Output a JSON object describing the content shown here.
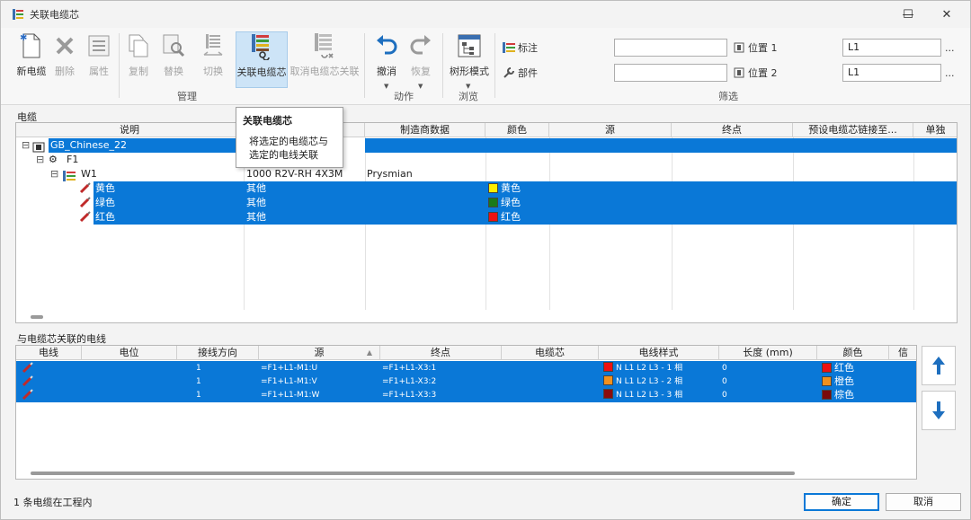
{
  "window": {
    "title": "关联电缆芯",
    "minimize": "—",
    "maximize": "☐",
    "close": "✕"
  },
  "toolbar": {
    "new_cable": "新电缆",
    "delete": "删除",
    "properties": "属性",
    "copy": "复制",
    "replace": "替换",
    "switch": "切换",
    "link_core": "关联电缆芯",
    "unlink_core": "取消电缆芯关联",
    "undo": "撤消",
    "redo": "恢复",
    "tree_mode": "树形模式",
    "group_manage": "管理",
    "group_action": "动作",
    "group_browse": "浏览",
    "group_filter": "筛选",
    "mark": "标注",
    "part": "部件",
    "position1": "位置 1",
    "position2": "位置 2",
    "filter1_value": "",
    "filter2_value": "",
    "pos1_value": "L1",
    "pos2_value": "L1",
    "ellipsis": "..."
  },
  "tooltip": {
    "title": "关联电缆芯",
    "line1": "将选定的电缆芯与",
    "line2": "选定的电线关联"
  },
  "cable_panel": {
    "label": "电缆",
    "columns": [
      "说明",
      "",
      "制造商数据",
      "颜色",
      "源",
      "终点",
      "预设电缆芯链接至...",
      "单独"
    ],
    "rows": [
      {
        "name": "GB_Chinese_22",
        "desc": "",
        "mfr": "",
        "color": "",
        "color_hex": ""
      },
      {
        "name": "F1",
        "desc": "",
        "mfr": "",
        "color": "",
        "color_hex": ""
      },
      {
        "name": "W1",
        "desc": "1000 R2V-RH 4X3M",
        "mfr": "Prysmian",
        "color": "",
        "color_hex": ""
      },
      {
        "name": "黄色",
        "desc": "其他",
        "mfr": "",
        "color": "黄色",
        "color_hex": "#ffee00"
      },
      {
        "name": "绿色",
        "desc": "其他",
        "mfr": "",
        "color": "绿色",
        "color_hex": "#1a7a1a"
      },
      {
        "name": "红色",
        "desc": "其他",
        "mfr": "",
        "color": "红色",
        "color_hex": "#ee1111"
      }
    ]
  },
  "wire_panel": {
    "label": "与电缆芯关联的电线",
    "columns": [
      "电线",
      "电位",
      "接线方向",
      "源",
      "终点",
      "电缆芯",
      "电线样式",
      "长度 (mm)",
      "颜色",
      "信"
    ],
    "rows": [
      {
        "dir": "1",
        "src": "=F1+L1-M1:U",
        "dst": "=F1+L1-X3:1",
        "style": "N L1 L2 L3 - 1 相",
        "style_hex": "#ee1111",
        "len": "0",
        "color": "红色",
        "color_hex": "#ee1111"
      },
      {
        "dir": "1",
        "src": "=F1+L1-M1:V",
        "dst": "=F1+L1-X3:2",
        "style": "N L1 L2 L3 - 2 相",
        "style_hex": "#f0901e",
        "len": "0",
        "color": "橙色",
        "color_hex": "#f0901e"
      },
      {
        "dir": "1",
        "src": "=F1+L1-M1:W",
        "dst": "=F1+L1-X3:3",
        "style": "N L1 L2 L3 - 3 相",
        "style_hex": "#8b0c0c",
        "len": "0",
        "color": "棕色",
        "color_hex": "#7a0a0a"
      }
    ]
  },
  "status": {
    "text": "1 条电缆在工程内"
  },
  "buttons": {
    "ok": "确定",
    "cancel": "取消"
  }
}
